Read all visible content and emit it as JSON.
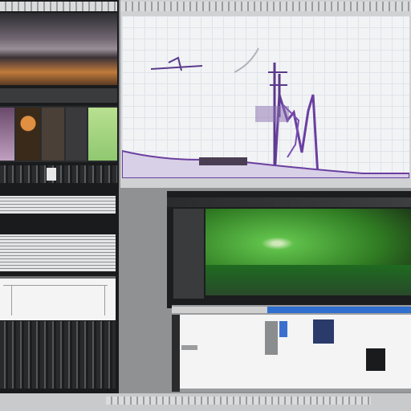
{
  "desktop": {
    "background": "#8f9192"
  },
  "left_panel": {
    "thumbnails": [
      "dusk-landscape",
      "color-swatches",
      "data-table",
      "white-document",
      "dark-table"
    ]
  },
  "main_window": {
    "subject": "rocket-launch-tower-sketch",
    "accent": "#6a3fa0"
  },
  "media_window": {
    "subject": "green-particle-burst",
    "accent": "#2f9e3a"
  },
  "editor_window": {
    "accent": "#2f6fd0"
  },
  "taskbar": {
    "background": "#c9cacb"
  }
}
